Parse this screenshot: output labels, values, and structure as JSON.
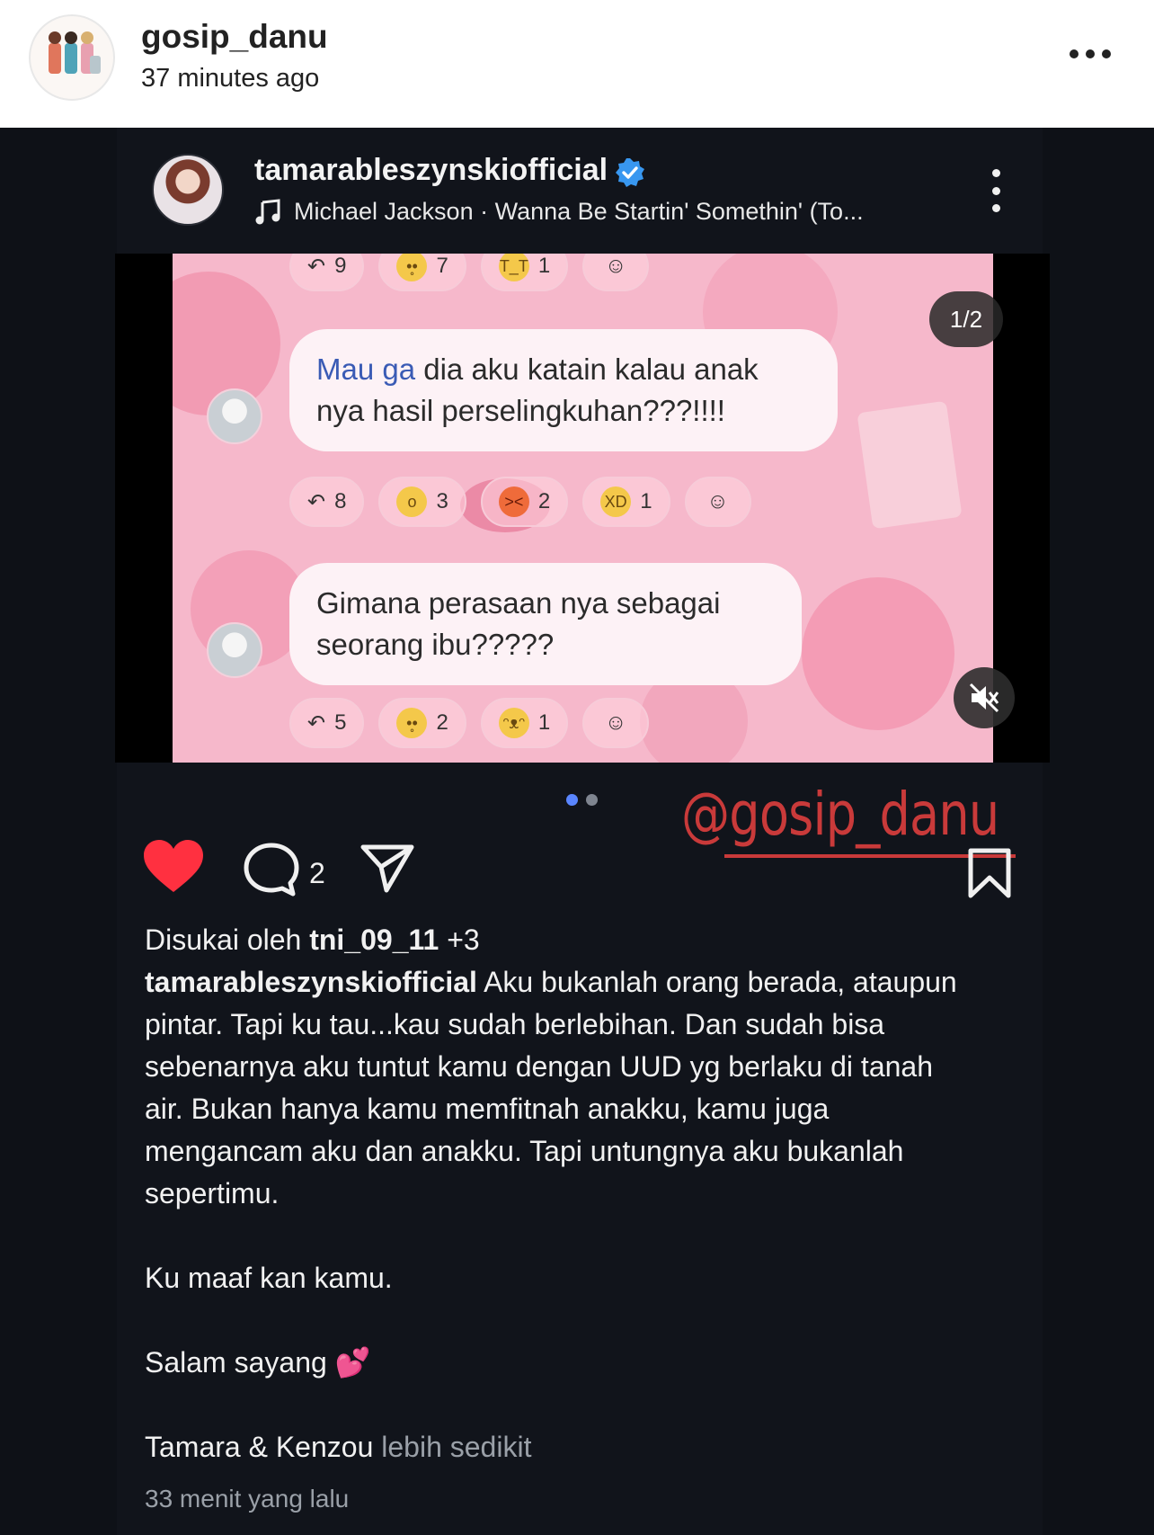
{
  "outer": {
    "username": "gosip_danu",
    "time": "37 minutes ago"
  },
  "post": {
    "username": "tamarableszynskiofficial",
    "music": "Michael Jackson · Wanna Be Startin' Somethin' (To...",
    "counter": "1/2",
    "reactions": {
      "row1": [
        "9",
        "7",
        "1"
      ],
      "row2": [
        "8",
        "3",
        "2",
        "1"
      ],
      "row3": [
        "5",
        "2",
        "1"
      ]
    },
    "messages": {
      "m1_blue": "Mau ga",
      "m1_line1_rest": " dia aku katain kalau anak",
      "m1_line2": "nya hasil perselingkuhan???!!!!",
      "m2_line1": "Gimana perasaan nya sebagai",
      "m2_line2": "seorang ibu?????"
    },
    "watermark": "@gosip_danu",
    "comment_count": "2",
    "liked_prefix": "Disukai oleh ",
    "liked_user": "tni_09_11",
    "liked_suffix": " +3",
    "caption_user": "tamarableszynskiofficial",
    "caption_lines": [
      " Aku bukanlah orang berada, ataupun",
      "pintar. Tapi ku tau...kau sudah berlebihan. Dan sudah bisa",
      "sebenarnya aku tuntut kamu dengan UUD yg berlaku di tanah",
      "air. Bukan hanya kamu memfitnah anakku, kamu juga",
      "mengancam aku dan anakku. Tapi untungnya aku bukanlah",
      "sepertimu."
    ],
    "caption_forgive": "Ku maaf kan kamu.",
    "caption_greeting": "Salam sayang 💕",
    "signature": "Tamara & Kenzou",
    "more_label": " lebih sedikit",
    "time_ago": "33 menit yang lalu"
  },
  "colors": {
    "background_dark": "#11141b",
    "heart": "#ff3040",
    "watermark": "#c93a3a",
    "verified": "#3897f0",
    "media_pink": "#f6b8cb"
  }
}
